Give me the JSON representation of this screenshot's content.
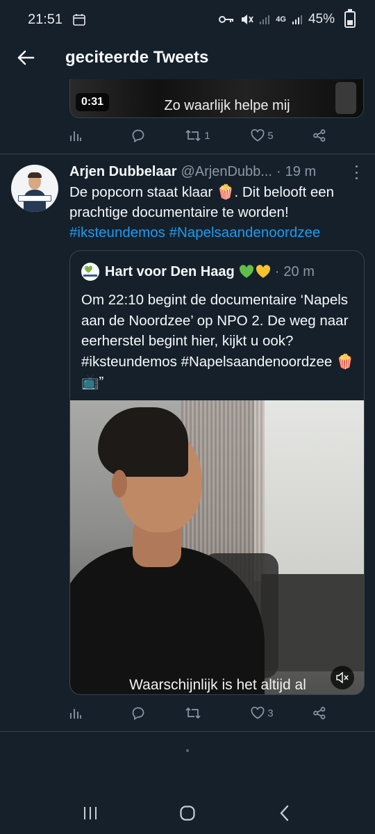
{
  "status_bar": {
    "time": "21:51",
    "battery": "45%",
    "network": "4G",
    "battery_level": 0.45
  },
  "header": {
    "title": "geciteerde Tweets"
  },
  "prev_tweet": {
    "video_duration": "0:31",
    "video_subtitle": "Zo waarlijk helpe mij",
    "actions": {
      "retweets": "1",
      "likes": "5"
    }
  },
  "tweet": {
    "author_name": "Arjen Dubbelaar",
    "author_handle": "@ArjenDubb...",
    "separator": "·",
    "time": "19 m",
    "text_before_emoji": "De popcorn staat klaar ",
    "emoji": "🍿",
    "text_after_emoji": ". Dit belooft een prachtige documentaire te worden!",
    "hashtag_1": "#iksteundemos",
    "hashtag_2": "#Napelsaandenoordzee",
    "quote": {
      "author_name": "Hart voor Den Haag",
      "time": "20 m",
      "text": "Om 22:10 begint de documentaire ‘Napels aan de Noordzee’ op NPO 2. De weg naar eerherstel begint hier, kijkt u ook? #iksteundemos #Napelsaandenoordzee 🍿📺”",
      "video_subtitle": "Waarschijnlijk is het altijd al"
    },
    "actions": {
      "likes": "3"
    }
  },
  "colors": {
    "background": "#15202b",
    "accent": "#1d9bf0",
    "muted": "#8b98a5",
    "border": "#38444d"
  },
  "icons": [
    "calendar-icon",
    "key-icon",
    "mute-icon",
    "signal-icon",
    "battery-icon",
    "back-arrow-icon",
    "stats-icon",
    "reply-icon",
    "retweet-icon",
    "like-icon",
    "share-icon",
    "more-icon",
    "green-heart-icon",
    "yellow-heart-icon",
    "volume-off-icon",
    "recents-icon",
    "home-icon",
    "nav-back-icon"
  ]
}
